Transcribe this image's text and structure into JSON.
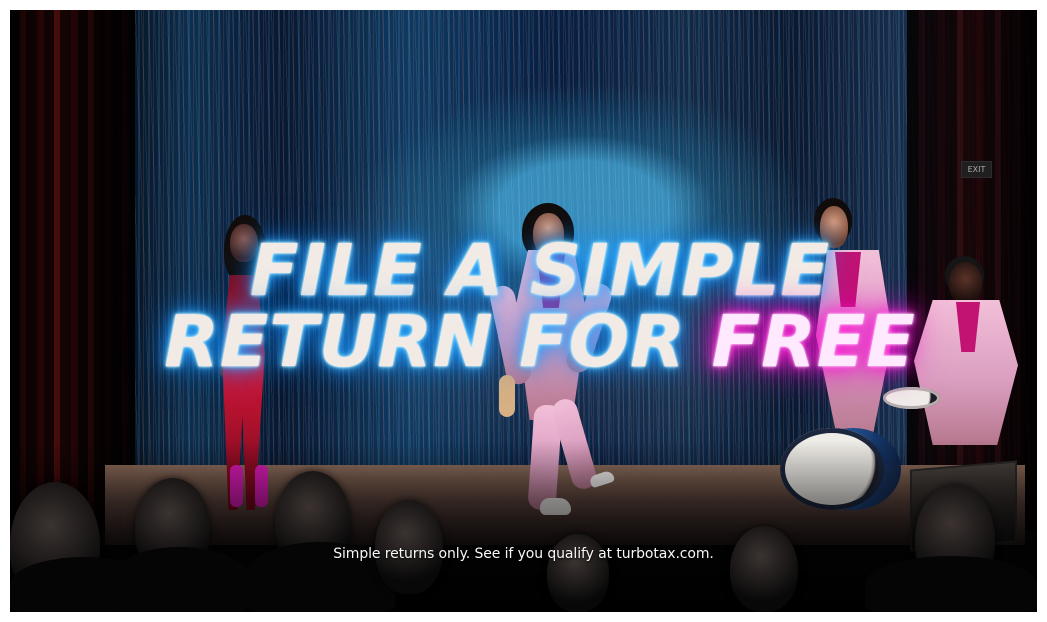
{
  "headline": {
    "line_1": "FILE A SIMPLE",
    "line_2_part_1": "RETURN FOR ",
    "line_2_part_2": "FREE"
  },
  "caption": "Simple returns only. See if you qualify at turbotax.com.",
  "exit_sign": "EXIT",
  "colors": {
    "headline_text": "#f2ebe5",
    "headline_glow_blue": "#168cff",
    "free_glow_pink": "#ff2bd2",
    "suit_pink": "#f2bfd8",
    "tinsel_blue": "#153c60"
  }
}
